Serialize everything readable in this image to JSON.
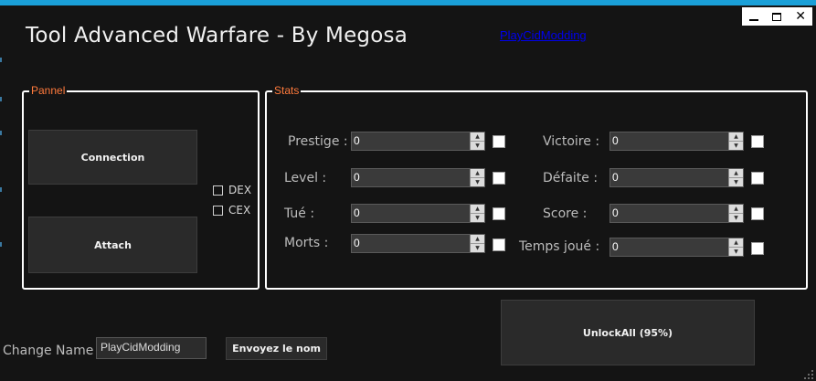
{
  "window": {
    "title": "Tool Advanced Warfare - By Megosa",
    "link": "PlayCidModding",
    "controls": {
      "minimize_icon": "minimize-icon",
      "maximize_icon": "maximize-icon",
      "close_glyph": "✕"
    }
  },
  "pannel": {
    "legend": "Pannel",
    "connection_label": "Connection",
    "attach_label": "Attach",
    "dex_label": "DEX",
    "cex_label": "CEX"
  },
  "stats": {
    "legend": "Stats",
    "left": [
      {
        "label": "Prestige :",
        "value": "0"
      },
      {
        "label": "Level :",
        "value": "0"
      },
      {
        "label": "Tué :",
        "value": "0"
      },
      {
        "label": "Morts :",
        "value": "0"
      }
    ],
    "right": [
      {
        "label": "Victoire :",
        "value": "0"
      },
      {
        "label": "Défaite :",
        "value": "0"
      },
      {
        "label": "Score :",
        "value": "0"
      },
      {
        "label": "Temps joué :",
        "value": "0"
      }
    ]
  },
  "unlock": {
    "label": "UnlockAll (95%)"
  },
  "change_name": {
    "label": "Change Name",
    "value": "PlayCidModding",
    "send_label": "Envoyez le nom"
  },
  "colors": {
    "accent": "#1aa0d8",
    "legend": "#ff7a3c",
    "background": "#141414"
  }
}
